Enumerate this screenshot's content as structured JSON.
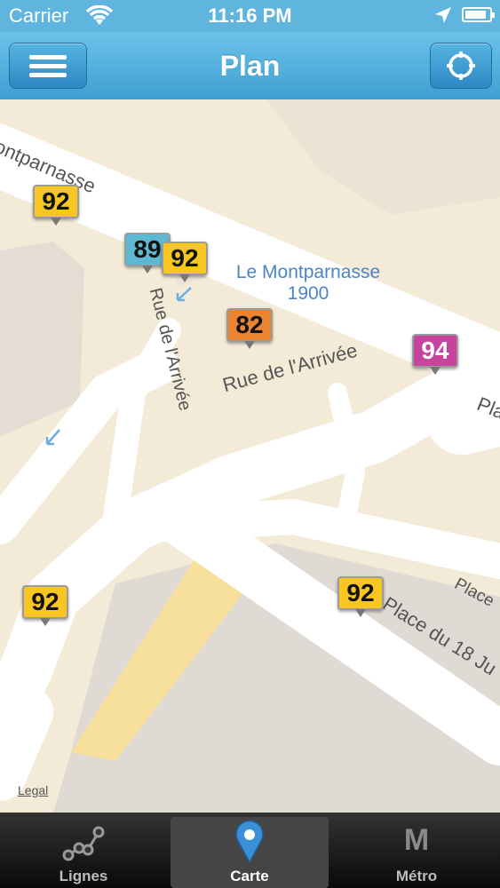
{
  "status_bar": {
    "carrier": "Carrier",
    "time": "11:16 PM",
    "icons": [
      "wifi-icon",
      "location-arrow-icon",
      "battery-icon"
    ],
    "battery_level": 0.9
  },
  "nav_bar": {
    "title": "Plan",
    "left_icon": "menu-icon",
    "right_icon": "crosshair-icon"
  },
  "map": {
    "labels": {
      "montparnasse_street": "ontparnasse",
      "rue_arrivee_vertical": "Rue de l'Arrivée",
      "rue_arrivee_main": "Rue de l'Arrivée",
      "place_partial_right": "Pla",
      "place_partial_small": "Place",
      "place_18_juin": "Place du 18 Ju"
    },
    "poi": {
      "name": "Le Montparnasse",
      "sub": "1900"
    },
    "markers": [
      {
        "line": "92",
        "color": "#f7c623"
      },
      {
        "line": "89",
        "color": "#5fb8d1"
      },
      {
        "line": "92",
        "color": "#f7c623"
      },
      {
        "line": "82",
        "color": "#ea8431"
      },
      {
        "line": "94",
        "color": "#c6439e"
      },
      {
        "line": "92",
        "color": "#f7c623"
      },
      {
        "line": "92",
        "color": "#f7c623"
      }
    ],
    "legal": "Legal"
  },
  "tab_bar": {
    "tabs": [
      {
        "label": "Lignes",
        "icon": "lines-icon"
      },
      {
        "label": "Carte",
        "icon": "map-pin-icon",
        "active": true
      },
      {
        "label": "Métro",
        "icon": "metro-m-icon",
        "glyph": "M"
      }
    ]
  }
}
